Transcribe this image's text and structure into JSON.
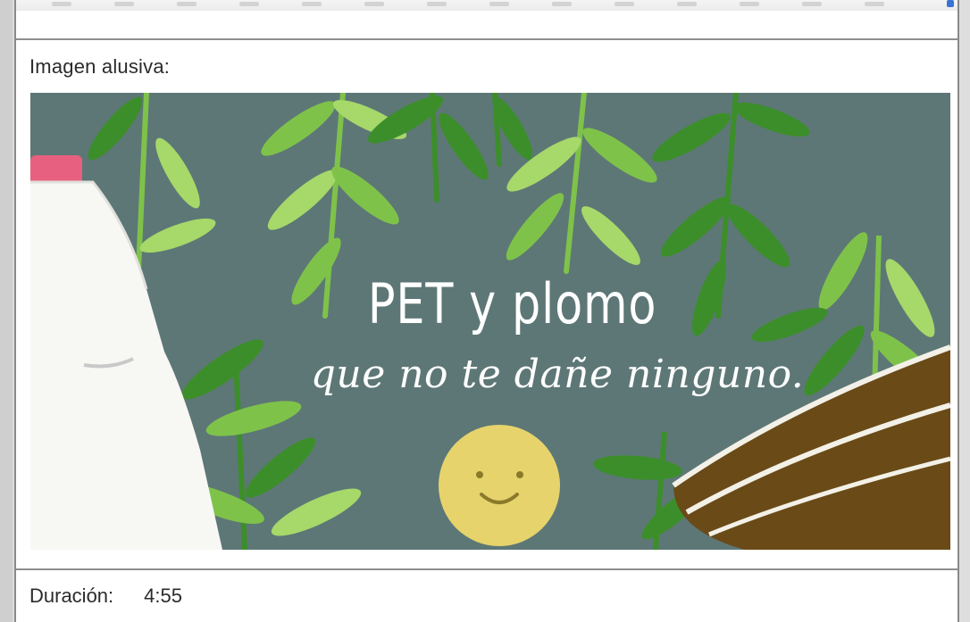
{
  "panel": {
    "image_label": "Imagen alusiva:",
    "duration_label": "Duración:",
    "duration_value": "4:55"
  },
  "image": {
    "title_line_1": "PET y plomo",
    "title_line_2": "que no te dañe ninguno.",
    "background_color": "#5d7776",
    "leaf_colors": [
      "#7fc24a",
      "#3c8e2a",
      "#a6d86a"
    ],
    "bottle_cap_color": "#e8607f",
    "coin_color": "#e6d36c",
    "bowl_color": "#6a4a17"
  },
  "icons": {
    "smiley": "smiley-face-icon",
    "bottle": "plastic-bottle-icon",
    "bowl": "clay-bowl-icon"
  },
  "colors": {
    "divider": "#8e8e8e",
    "text": "#2b2b2b",
    "accent": "#3b74d6"
  }
}
